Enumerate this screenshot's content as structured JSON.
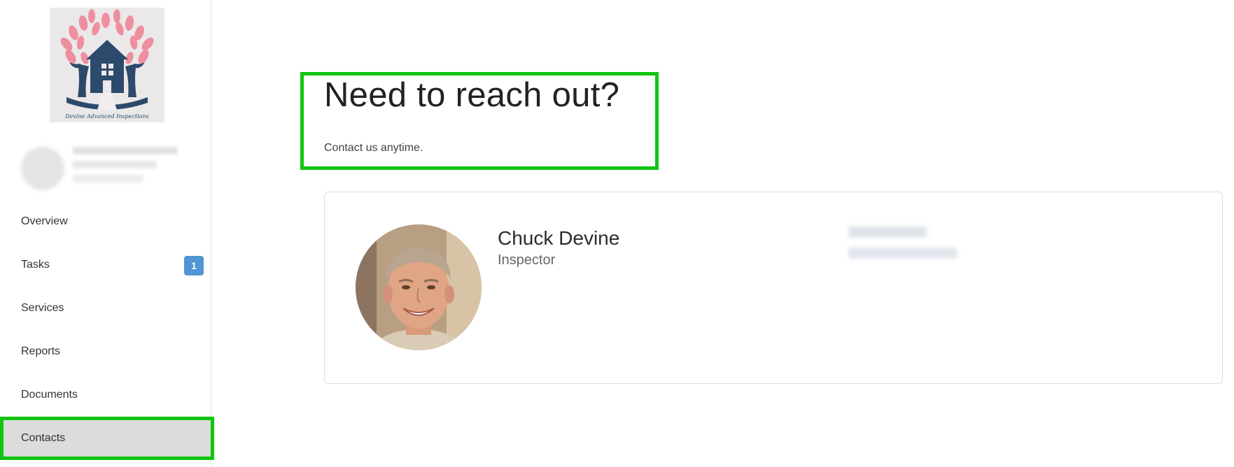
{
  "sidebar": {
    "logo": {
      "caption": "Devine Advanced Inspections",
      "icon": "tree-house-logo"
    },
    "user": {
      "name": "",
      "detail": ""
    },
    "items": [
      {
        "label": "Overview"
      },
      {
        "label": "Tasks",
        "badge": "1"
      },
      {
        "label": "Services"
      },
      {
        "label": "Reports"
      },
      {
        "label": "Documents"
      },
      {
        "label": "Contacts",
        "active": true
      }
    ]
  },
  "main": {
    "title": "Need to reach out?",
    "subtitle": "Contact us anytime.",
    "contact": {
      "name": "Chuck Devine",
      "role": "Inspector",
      "photo_icon": "person-portrait",
      "email": "",
      "phone": ""
    }
  },
  "colors": {
    "highlight": "#11c511",
    "badge": "#4f96d3",
    "active_bg": "#dcdcdc",
    "logo_navy": "#2c4a6b",
    "logo_pink": "#ee8fa0"
  }
}
